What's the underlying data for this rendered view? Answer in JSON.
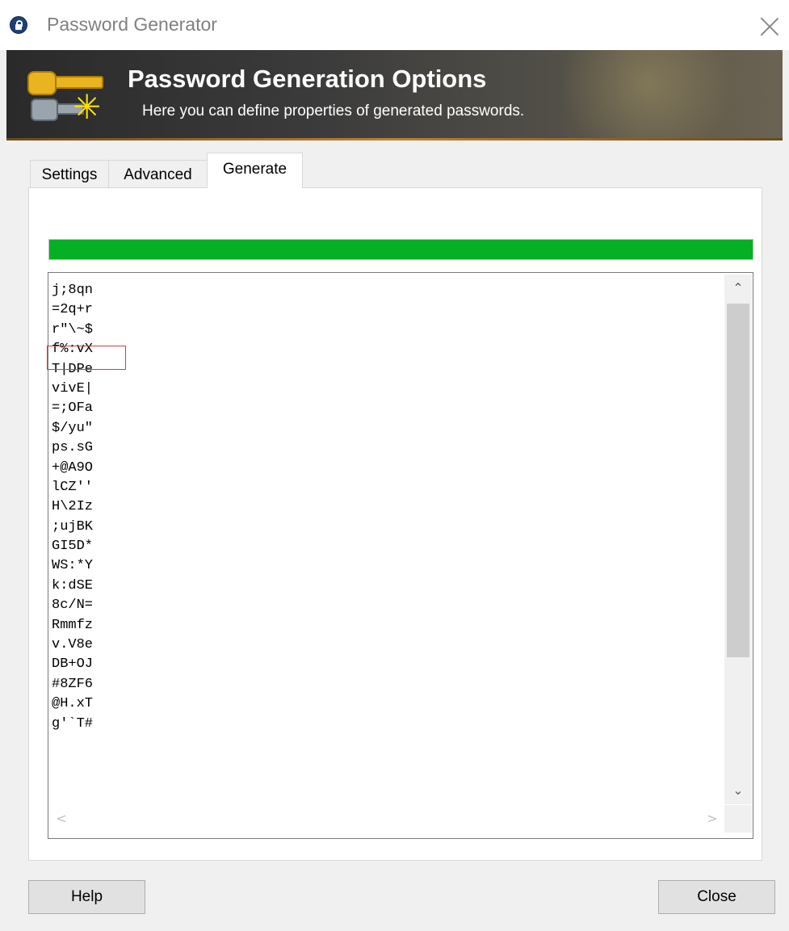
{
  "window": {
    "title": "Password Generator"
  },
  "banner": {
    "title": "Password Generation Options",
    "subtitle": "Here you can define properties of generated passwords."
  },
  "tabs": [
    {
      "label": "Settings",
      "active": false
    },
    {
      "label": "Advanced",
      "active": false
    },
    {
      "label": "Generate",
      "active": true
    }
  ],
  "quality": {
    "percent": 100,
    "color": "#06b025"
  },
  "passwords": [
    "j;8qn",
    "=2q+r",
    "r\"\\~$",
    "f%:vX",
    "T|DPe",
    "vivE|",
    "=;OFa",
    "$/yu\"",
    "ps.sG",
    "+@A9O",
    "lCZ''",
    "H\\2Iz",
    ";ujBK",
    "GI5D*",
    "WS:*Y",
    "k:dSE",
    "8c/N=",
    "Rmmfz",
    "v.V8e",
    "DB+OJ",
    "#8ZF6",
    "@H.xT",
    "g'`T#"
  ],
  "highlighted_password": "f%:vX",
  "buttons": {
    "help": "Help",
    "close": "Close"
  },
  "icons": {
    "app": "lock-icon",
    "banner": "keys-generate-icon",
    "close": "close-icon"
  }
}
